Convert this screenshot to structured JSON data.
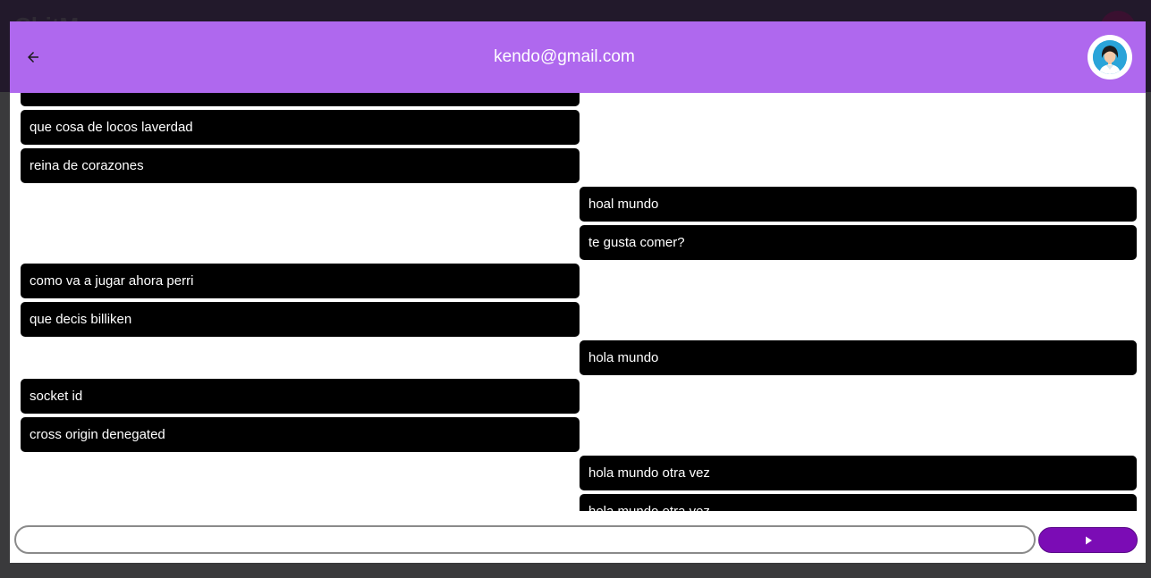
{
  "background": {
    "app_title": "ChitM"
  },
  "dialog": {
    "title": "kendo@gmail.com",
    "back_icon": "arrow-left-icon",
    "avatar_icon": "user-avatar-icon"
  },
  "messages": [
    {
      "side": "left",
      "text": ""
    },
    {
      "side": "left",
      "text": "que cosa de locos laverdad"
    },
    {
      "side": "left",
      "text": "reina de corazones"
    },
    {
      "side": "right",
      "text": "hoal mundo"
    },
    {
      "side": "right",
      "text": "te gusta comer?"
    },
    {
      "side": "left",
      "text": "como va a jugar ahora perri"
    },
    {
      "side": "left",
      "text": "que decis billiken"
    },
    {
      "side": "right",
      "text": "hola mundo"
    },
    {
      "side": "left",
      "text": "socket id"
    },
    {
      "side": "left",
      "text": "cross origin denegated"
    },
    {
      "side": "right",
      "text": "hola mundo otra vez"
    },
    {
      "side": "right",
      "text": "hola mundo otra vez"
    }
  ],
  "composer": {
    "input_value": "",
    "input_placeholder": "",
    "send_icon": "play-arrow-icon"
  },
  "colors": {
    "header": "#af68ee",
    "send_button": "#7b0cb5",
    "bubble": "#000000"
  }
}
